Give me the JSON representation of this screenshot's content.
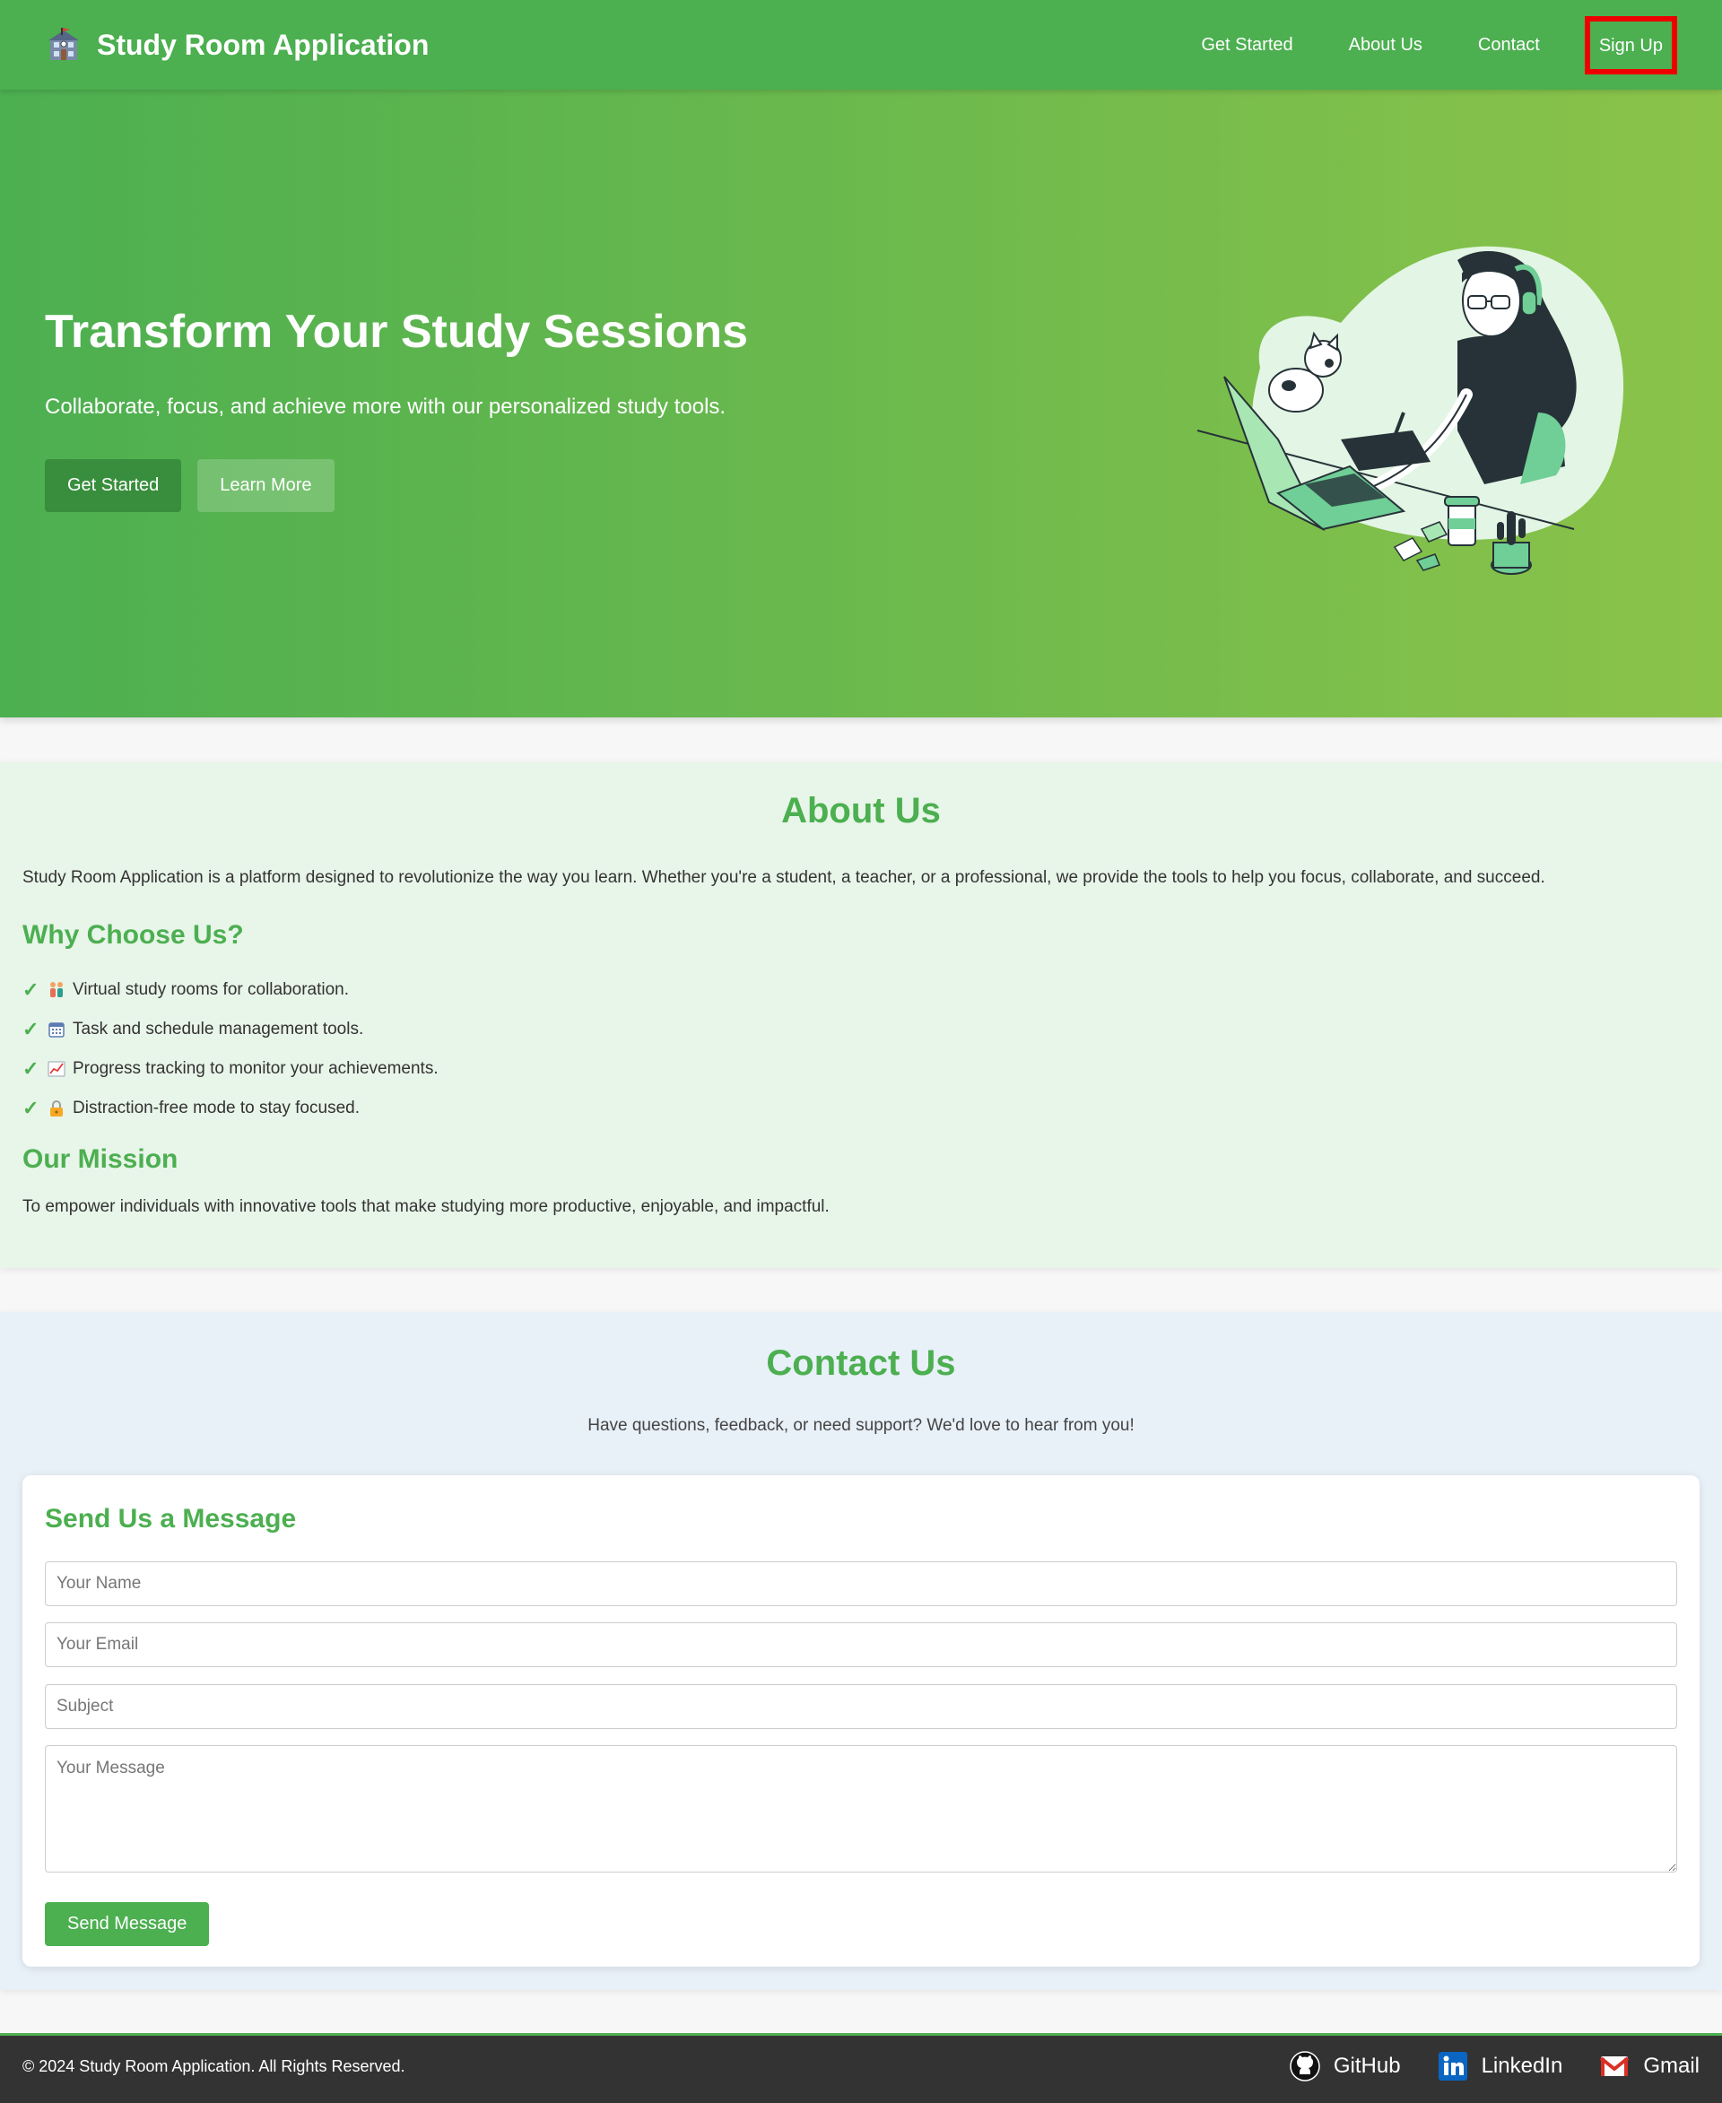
{
  "nav": {
    "brand": "Study Room Application",
    "brand_icon": "school-building-icon",
    "links": [
      "Get Started",
      "About Us",
      "Contact"
    ],
    "signup": "Sign Up"
  },
  "hero": {
    "title": "Transform Your Study Sessions",
    "subtitle": "Collaborate, focus, and achieve more with our personalized study tools.",
    "primary_button": "Get Started",
    "secondary_button": "Learn More",
    "illustration": "woman-studying-with-laptop-and-cat-illustration"
  },
  "about": {
    "title": "About Us",
    "description": "Study Room Application is a platform designed to revolutionize the way you learn. Whether you're a student, a teacher, or a professional, we provide the tools to help you focus, collaborate, and succeed.",
    "why_title": "Why Choose Us?",
    "features": [
      {
        "icon": "people-icon",
        "text": "Virtual study rooms for collaboration."
      },
      {
        "icon": "calendar-icon",
        "text": "Task and schedule management tools."
      },
      {
        "icon": "chart-icon",
        "text": "Progress tracking to monitor your achievements."
      },
      {
        "icon": "lock-icon",
        "text": "Distraction-free mode to stay focused."
      }
    ],
    "mission_title": "Our Mission",
    "mission_text": "To empower individuals with innovative tools that make studying more productive, enjoyable, and impactful."
  },
  "contact": {
    "title": "Contact Us",
    "subtitle": "Have questions, feedback, or need support? We'd love to hear from you!",
    "form_title": "Send Us a Message",
    "name_placeholder": "Your Name",
    "email_placeholder": "Your Email",
    "subject_placeholder": "Subject",
    "message_placeholder": "Your Message",
    "submit": "Send Message"
  },
  "footer": {
    "copyright": "© 2024 Study Room Application. All Rights Reserved.",
    "links": [
      {
        "label": "GitHub",
        "icon": "github-icon"
      },
      {
        "label": "LinkedIn",
        "icon": "linkedin-icon"
      },
      {
        "label": "Gmail",
        "icon": "gmail-icon"
      }
    ]
  },
  "colors": {
    "primary": "#4caf50",
    "primary_dark": "#388e3c",
    "gradient_end": "#8bc34a",
    "about_bg": "#e8f5e9",
    "contact_bg": "#e8f0f8",
    "footer_bg": "#333333",
    "highlight": "#ee0000"
  }
}
